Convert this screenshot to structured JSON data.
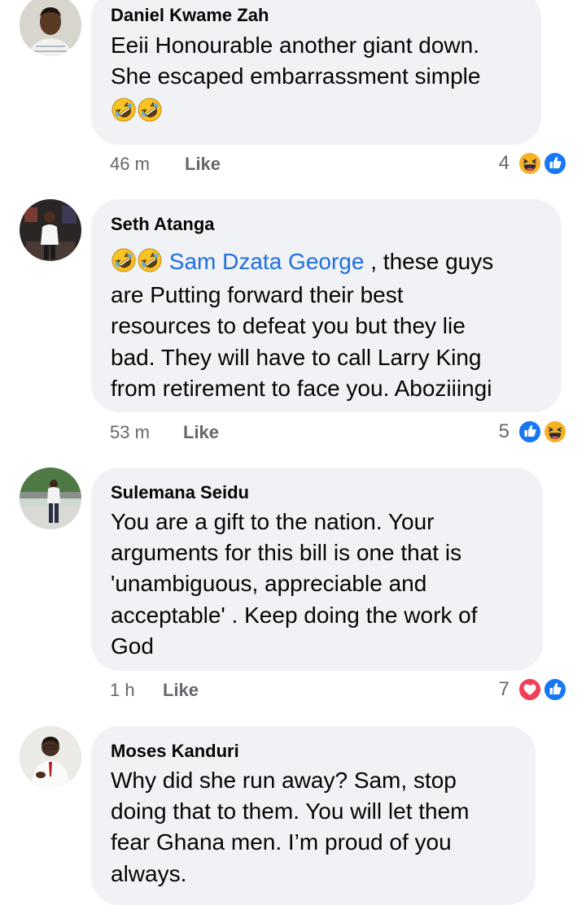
{
  "comments": [
    {
      "author": "Daniel Kwame Zah",
      "lines": [
        "Eeii Honourable another giant down.",
        "She escaped embarrassment simple"
      ],
      "emoji_line": [
        "rolling-laughing-icon",
        "rolling-laughing-icon"
      ],
      "time": "46 m",
      "like_label": "Like",
      "reaction_count": "4",
      "reactions": [
        "haha-reaction-icon",
        "like-reaction-icon"
      ]
    },
    {
      "author": "Seth Atanga",
      "first_line_mention": "Sam Dzata George",
      "first_line_suffix": " , these guys",
      "lines": [
        "are Putting forward their best",
        "resources to defeat you but they lie",
        "bad. They will have to call Larry King",
        "from retirement to face you. Aboziiingi"
      ],
      "time": "53 m",
      "like_label": "Like",
      "reaction_count": "5",
      "reactions": [
        "like-reaction-icon",
        "haha-reaction-icon"
      ]
    },
    {
      "author": "Sulemana Seidu",
      "lines": [
        "You are a gift to the nation. Your",
        "arguments for this bill is one that is",
        "'unambiguous, appreciable and",
        "acceptable' . Keep doing the work of",
        "God"
      ],
      "time": "1 h",
      "like_label": "Like",
      "reaction_count": "7",
      "reactions": [
        "love-reaction-icon",
        "like-reaction-icon"
      ]
    },
    {
      "author": "Moses Kanduri",
      "lines": [
        "Why did she run away? Sam, stop",
        "doing that to them. You will let them",
        "fear Ghana men. I’m proud of you",
        "always."
      ]
    }
  ],
  "colors": {
    "bubble": "#f0f2f5",
    "mention": "#216fdb",
    "meta": "#65676b",
    "like_blue": "#1877f2",
    "love_red": "#f33e58",
    "haha_yellow": "#f7b125"
  }
}
